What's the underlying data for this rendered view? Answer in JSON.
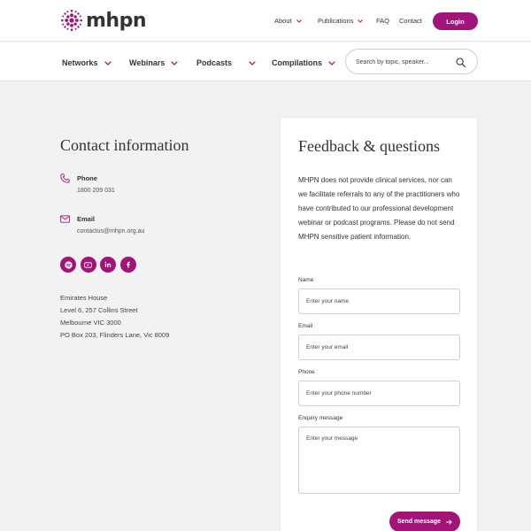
{
  "brand": {
    "name": "mhpn",
    "accent": "#a3147b"
  },
  "topnav": {
    "about": "About",
    "publications": "Publications",
    "faq": "FAQ",
    "contact": "Contact",
    "login": "Login"
  },
  "mainnav": {
    "networks": "Networks",
    "webinars": "Webinars",
    "podcasts": "Podcasts",
    "compilations": "Compilations"
  },
  "search": {
    "placeholder": "Search by topic, speaker...",
    "icon": "search-icon"
  },
  "contact": {
    "title": "Contact information",
    "phone_label": "Phone",
    "phone_value": "1800 209 031",
    "email_label": "Email",
    "email_value": "contactus@mhpn.org.au",
    "socials": [
      "spotify-icon",
      "youtube-icon",
      "linkedin-icon",
      "facebook-icon"
    ],
    "address": [
      "Emirates House",
      "Level 6, 257 Collins Street",
      "Melbourne VIC 3000",
      "PO Box 203, Flinders Lane, Vic 8009"
    ]
  },
  "feedback": {
    "title": "Feedback & questions",
    "text": "MHPN does not provide clinical services, nor can we facilitate referrals to any of the practitioners who have contributed to our professional development webinar or podcast programs. Please do not send MHPN sensitive patient information.",
    "name_label": "Name",
    "name_placeholder": "Enter your name",
    "email_label": "Email",
    "email_placeholder": "Enter your email",
    "phone_label": "Phone",
    "phone_placeholder": "Enter your phone number",
    "message_label": "Enquiry message",
    "message_placeholder": "Enter your message",
    "send": "Send message"
  }
}
